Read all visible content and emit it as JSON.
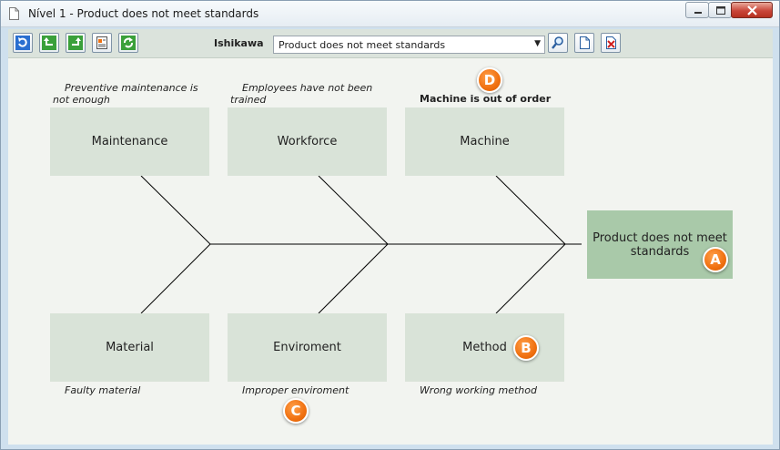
{
  "window": {
    "title": "Nível 1 - Product does not meet standards"
  },
  "toolbar": {
    "label": "Ishikawa",
    "select_value": "Product does not meet standards"
  },
  "effect": {
    "text": "Product does not meet standards"
  },
  "causes": {
    "maintenance": {
      "label": "Maintenance",
      "note": "Preventive maintenance is not enough"
    },
    "workforce": {
      "label": "Workforce",
      "note": "Employees have not been trained"
    },
    "machine": {
      "label": "Machine",
      "note": "Machine is out of order"
    },
    "material": {
      "label": "Material",
      "note": "Faulty material"
    },
    "enviroment": {
      "label": "Enviroment",
      "note": "Improper enviroment"
    },
    "method": {
      "label": "Method",
      "note": "Wrong working method"
    }
  },
  "badges": {
    "a": "A",
    "b": "B",
    "c": "C",
    "d": "D"
  },
  "colors": {
    "accent": "#f07010",
    "box": "#d9e3d8",
    "effect_box": "#a9c9a9"
  }
}
